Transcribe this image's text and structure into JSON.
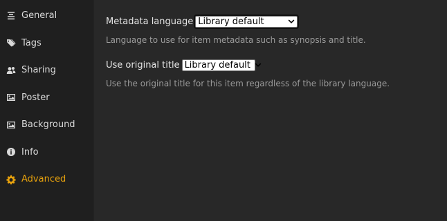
{
  "sidebar": {
    "items": [
      {
        "label": "General",
        "icon": "general-icon",
        "active": false
      },
      {
        "label": "Tags",
        "icon": "tags-icon",
        "active": false
      },
      {
        "label": "Sharing",
        "icon": "users-icon",
        "active": false
      },
      {
        "label": "Poster",
        "icon": "image-icon",
        "active": false
      },
      {
        "label": "Background",
        "icon": "image-icon",
        "active": false
      },
      {
        "label": "Info",
        "icon": "info-icon",
        "active": false
      },
      {
        "label": "Advanced",
        "icon": "gear-icon",
        "active": true
      }
    ]
  },
  "form": {
    "metadata_language": {
      "label": "Metadata language",
      "value": "Library default",
      "help": "Language to use for item metadata such as synopsis and title."
    },
    "use_original_title": {
      "label": "Use original title",
      "value": "Library default",
      "help": "Use the original title for this item regardless of the library language."
    }
  },
  "colors": {
    "accent": "#e5a00d",
    "sidebar_bg": "#1f1f1f",
    "content_bg": "#282828"
  }
}
